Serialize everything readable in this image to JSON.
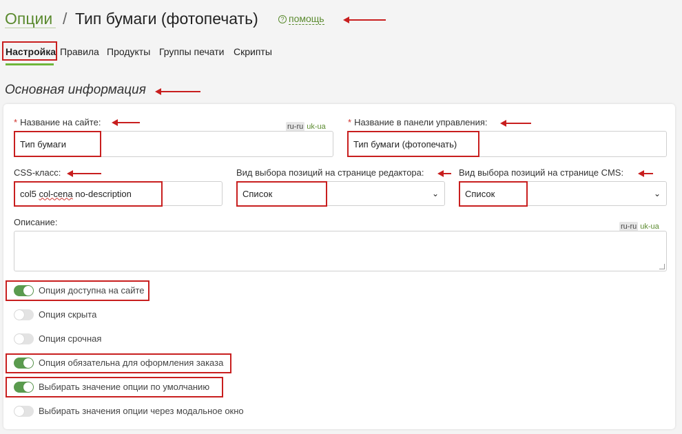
{
  "header": {
    "breadcrumb_root": "Опции",
    "separator": "/",
    "title": "Тип бумаги (фотопечать)",
    "help_icon": "?",
    "help_label": "помощь"
  },
  "tabs": [
    {
      "label": "Настройка",
      "active": true
    },
    {
      "label": "Правила"
    },
    {
      "label": "Продукты"
    },
    {
      "label": "Группы печати"
    },
    {
      "label": "Скрипты"
    }
  ],
  "section": {
    "title": "Основная информация"
  },
  "form": {
    "required_mark": "*",
    "site_name": {
      "label": "Название на сайте:",
      "value": "Тип бумаги",
      "lang_ru": "ru-ru",
      "lang_uk": "uk-ua"
    },
    "admin_name": {
      "label": "Название в панели управления:",
      "value": "Тип бумаги (фотопечать)"
    },
    "css_class": {
      "label": "CSS-класс:",
      "value_part1": "col5 ",
      "value_part2": "col-cena",
      "value_part3": " no-description"
    },
    "editor_select": {
      "label": "Вид выбора позиций на странице редактора:",
      "value": "Список"
    },
    "cms_select": {
      "label": "Вид выбора позиций на странице CMS:",
      "value": "Список"
    },
    "description": {
      "label": "Описание:",
      "value": "",
      "lang_ru": "ru-ru",
      "lang_uk": "uk-ua"
    },
    "chevron_glyph": "⌄"
  },
  "toggles": [
    {
      "label": "Опция доступна на сайте",
      "on": true
    },
    {
      "label": "Опция скрыта",
      "on": false
    },
    {
      "label": "Опция срочная",
      "on": false
    },
    {
      "label": "Опция обязательна для оформления заказа",
      "on": true
    },
    {
      "label": "Выбирать значение опции по умолчанию",
      "on": true
    },
    {
      "label": "Выбирать значения опции через модальное окно",
      "on": false
    }
  ],
  "colors": {
    "accent": "#5a8a2e",
    "toggle_on": "#5a9b4e",
    "annotation": "#c81e1e"
  }
}
